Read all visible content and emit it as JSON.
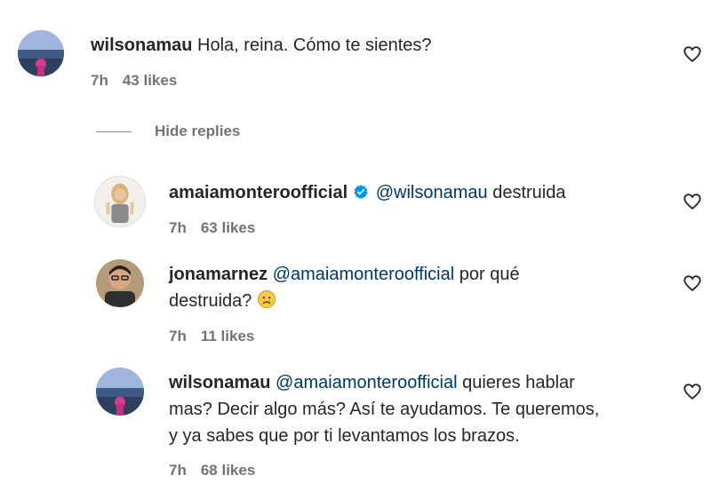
{
  "comments": [
    {
      "username": "wilsonamau",
      "mention": "",
      "text": "Hola, reina. Cómo te sientes?",
      "time": "7h",
      "likes": "43 likes"
    }
  ],
  "hide_replies_label": "Hide replies",
  "replies": [
    {
      "username": "amaiamonteroofficial",
      "verified": true,
      "mention": "@wilsonamau",
      "text": " destruida",
      "time": "7h",
      "likes": "63 likes"
    },
    {
      "username": "jonamarnez",
      "mention": "@amaiamonteroofficial",
      "text_line1": " por qué",
      "text_line2": "destruida? ",
      "emoji": "crying-face",
      "time": "7h",
      "likes": "11 likes"
    },
    {
      "username": "wilsonamau",
      "mention": "@amaiamonteroofficial",
      "text_line1": " quieres hablar",
      "text_line2": "mas? Decir algo más? Así te ayudamos. Te queremos,",
      "text_line3": "y ya sabes que por ti levantamos los brazos.",
      "time": "7h",
      "likes": "68 likes"
    }
  ],
  "colors": {
    "text": "#262626",
    "secondary": "#737373",
    "mention": "#00376b",
    "verified": "#0095f6"
  },
  "icons": [
    "heart-outline-icon",
    "verified-badge-icon",
    "crying-face-emoji"
  ]
}
